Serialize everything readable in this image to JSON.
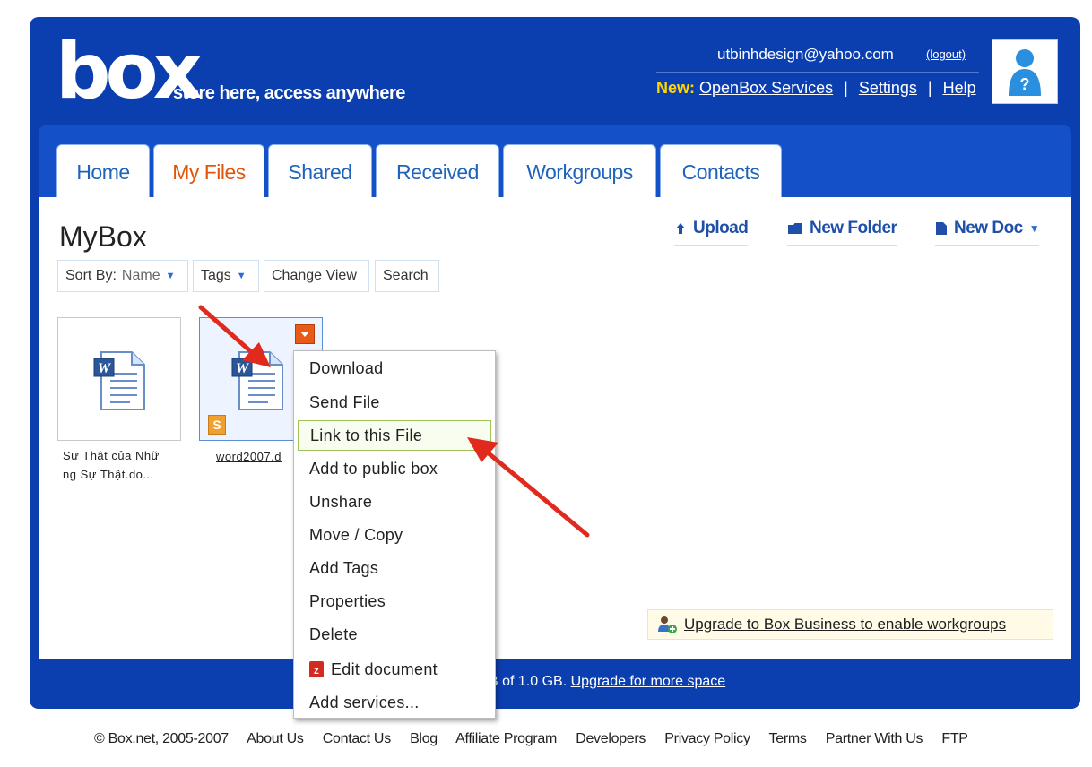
{
  "header": {
    "logo_text": "box",
    "tagline": "store here, access anywhere",
    "user_email": "utbinhdesign@yahoo.com",
    "logout_label": "(logout)",
    "new_label": "New:",
    "links": [
      "OpenBox Services",
      "Settings",
      "Help"
    ]
  },
  "tabs": [
    {
      "label": "Home"
    },
    {
      "label": "My Files"
    },
    {
      "label": "Shared"
    },
    {
      "label": "Received"
    },
    {
      "label": "Workgroups"
    },
    {
      "label": "Contacts"
    }
  ],
  "main": {
    "title": "MyBox",
    "actions": {
      "upload": "Upload",
      "new_folder": "New Folder",
      "new_doc": "New Doc"
    },
    "toolbar": {
      "sort_label": "Sort By:",
      "sort_value": "Name",
      "tags_label": "Tags",
      "change_view_label": "Change View",
      "search_label": "Search"
    },
    "files": [
      {
        "name_line1": "Sự Thật của Nhữ",
        "name_line2": "ng Sự Thật.do..."
      },
      {
        "name": "word2007.d"
      }
    ],
    "share_badge": "S"
  },
  "context_menu": {
    "items": [
      {
        "label": "Download"
      },
      {
        "label": "Send File"
      },
      {
        "label": "Link to this File"
      },
      {
        "label": "Add to public box"
      },
      {
        "label": "Unshare"
      },
      {
        "label": "Move / Copy"
      },
      {
        "label": "Add Tags"
      },
      {
        "label": "Properties"
      },
      {
        "label": "Delete"
      },
      {
        "label": "Edit document"
      },
      {
        "label": "Add services..."
      }
    ]
  },
  "upgrade": {
    "label": "Upgrade to Box Business to enable workgroups"
  },
  "storage": {
    "text": "B of 1.0 GB.",
    "link": "Upgrade for more space"
  },
  "footer": {
    "copyright": "© Box.net, 2005-2007",
    "links": [
      "About Us",
      "Contact Us",
      "Blog",
      "Affiliate Program",
      "Developers",
      "Privacy Policy",
      "Terms",
      "Partner With Us",
      "FTP"
    ]
  },
  "colors": {
    "brand_blue": "#0b3fb0",
    "tab_band": "#1451c8",
    "active_tab": "#e2560c",
    "tab_text": "#1f63bb",
    "accent_yellow": "#ffd600",
    "annotation_arrow": "#e02a1e"
  },
  "icons": [
    "word-doc-icon",
    "menu-toggle-icon",
    "share-icon",
    "upload-icon",
    "folder-icon",
    "doc-icon",
    "user-icon",
    "workgroup-icon",
    "zoho-icon"
  ]
}
